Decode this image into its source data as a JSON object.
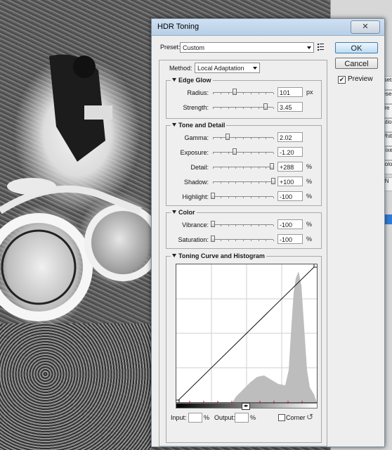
{
  "dialog": {
    "title": "HDR Toning",
    "close_glyph": "✕",
    "preset_label": "Preset:",
    "preset_value": "Custom",
    "ok_label": "OK",
    "cancel_label": "Cancel",
    "preview_label": "Preview",
    "preview_checked": true,
    "method_label": "Method:",
    "method_value": "Local Adaptation"
  },
  "edge_glow": {
    "header": "Edge Glow",
    "radius": {
      "label": "Radius:",
      "value": "101",
      "unit": "px",
      "level": 0.36
    },
    "strength": {
      "label": "Strength:",
      "value": "3.45",
      "level": 0.87
    }
  },
  "tone_detail": {
    "header": "Tone and Detail",
    "gamma": {
      "label": "Gamma:",
      "value": "2.02",
      "level": 0.24
    },
    "exposure": {
      "label": "Exposure:",
      "value": "-1.20",
      "level": 0.36
    },
    "detail": {
      "label": "Detail:",
      "value": "+288",
      "unit": "%",
      "level": 0.98
    },
    "shadow": {
      "label": "Shadow:",
      "value": "+100",
      "unit": "%",
      "level": 1.0
    },
    "highlight": {
      "label": "Highlight:",
      "value": "-100",
      "unit": "%",
      "level": 0.0
    }
  },
  "color": {
    "header": "Color",
    "vibrance": {
      "label": "Vibrance:",
      "value": "-100",
      "unit": "%",
      "level": 0.0
    },
    "saturation": {
      "label": "Saturation:",
      "value": "-100",
      "unit": "%",
      "level": 0.0
    }
  },
  "curve": {
    "header": "Toning Curve and Histogram",
    "input_label": "Input:",
    "input_unit": "%",
    "output_label": "Output:",
    "output_unit": "%",
    "corner_label": "Corner",
    "reset_glyph": "↺"
  },
  "ps_panel": {
    "fragments": [
      "esets",
      "rese",
      "Pre",
      "ratio",
      "Whit",
      "Mixe",
      "Colo",
      "NN"
    ]
  },
  "colors": {
    "dialog_bg": "#eeeeee",
    "ok_accent": "#3c7fb1",
    "histogram": "#bdbdbd"
  }
}
